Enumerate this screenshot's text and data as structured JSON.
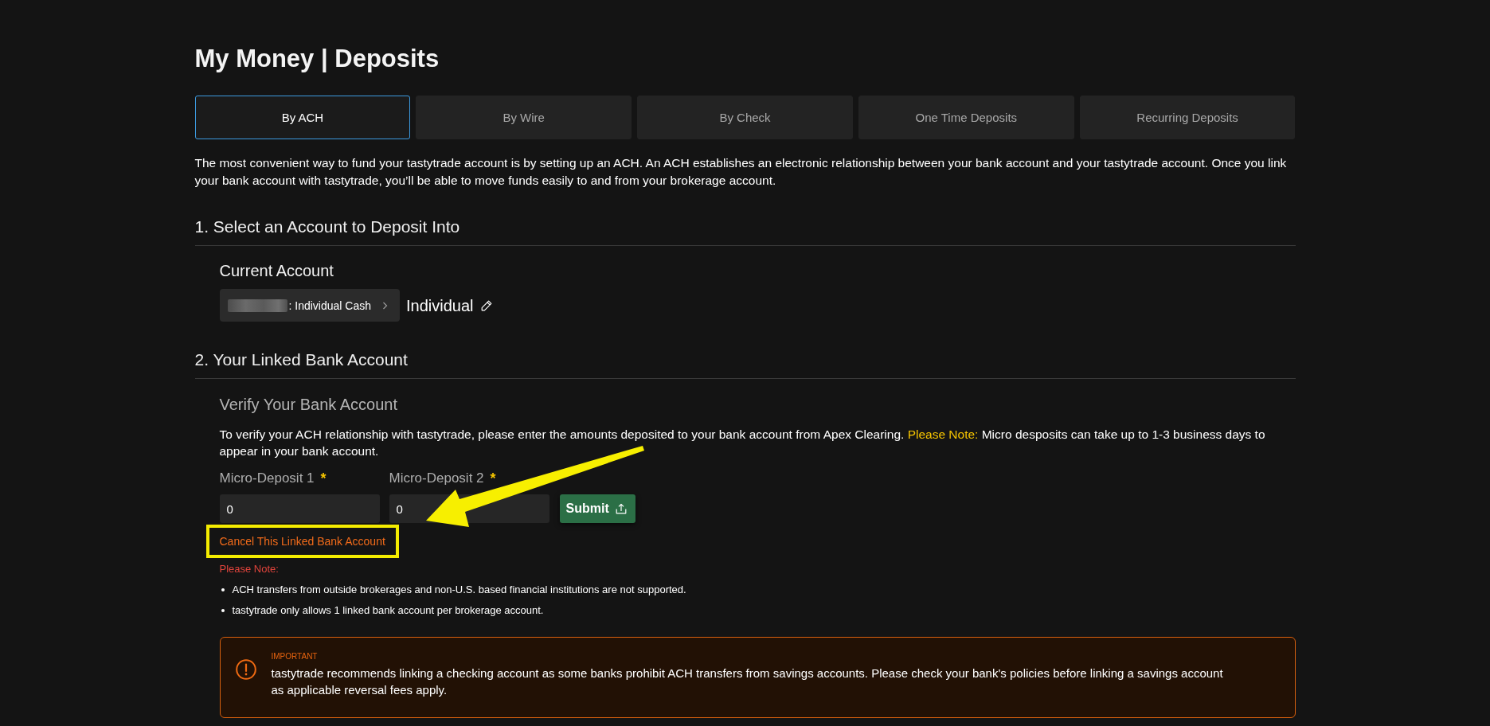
{
  "page": {
    "title": "My Money | Deposits"
  },
  "tabs": [
    {
      "label": "By ACH",
      "selected": true
    },
    {
      "label": "By Wire",
      "selected": false
    },
    {
      "label": "By Check",
      "selected": false
    },
    {
      "label": "One Time Deposits",
      "selected": false
    },
    {
      "label": "Recurring Deposits",
      "selected": false
    }
  ],
  "intro": "The most convenient way to fund your tastytrade account is by setting up an ACH. An ACH establishes an electronic relationship between your bank account and your tastytrade account. Once you link your bank account with tastytrade, you’ll be able to move funds easily to and from your brokerage account.",
  "account_section": {
    "heading": "1. Select an Account to Deposit Into",
    "subheading": "Current Account",
    "account_selector": {
      "label": ": Individual Cash"
    },
    "account_nickname": "Individual"
  },
  "bank_section": {
    "heading": "2. Your Linked Bank Account",
    "subheading": "Verify Your Bank Account",
    "instructions": "To verify your ACH relationship with tastytrade, please enter the amounts deposited to your bank account from Apex Clearing.",
    "note_label": "Please Note:",
    "note_text": "Micro desposits can take up to 1-3 business days to appear in your bank account.",
    "fields": [
      {
        "label": "Micro-Deposit 1",
        "required_mark": "*",
        "value": "0"
      },
      {
        "label": "Micro-Deposit 2",
        "required_mark": "*",
        "value": "0"
      }
    ],
    "submit_button": {
      "label": "Submit"
    },
    "cancel_link": {
      "label": "Cancel This Linked Bank Account",
      "highlighted": true
    },
    "notes": {
      "heading": "Please Note:",
      "items": [
        "ACH transfers from outside brokerages and non-U.S. based financial institutions are not supported.",
        "tastytrade only allows 1 linked bank account per brokerage account."
      ]
    },
    "important": {
      "title": "IMPORTANT",
      "text": "tastytrade recommends linking a checking account as some banks prohibit ACH transfers from savings accounts. Please check your bank's policies before linking a savings account as applicable reversal fees apply."
    }
  },
  "annotations": [
    {
      "kind": "arrow"
    }
  ]
}
